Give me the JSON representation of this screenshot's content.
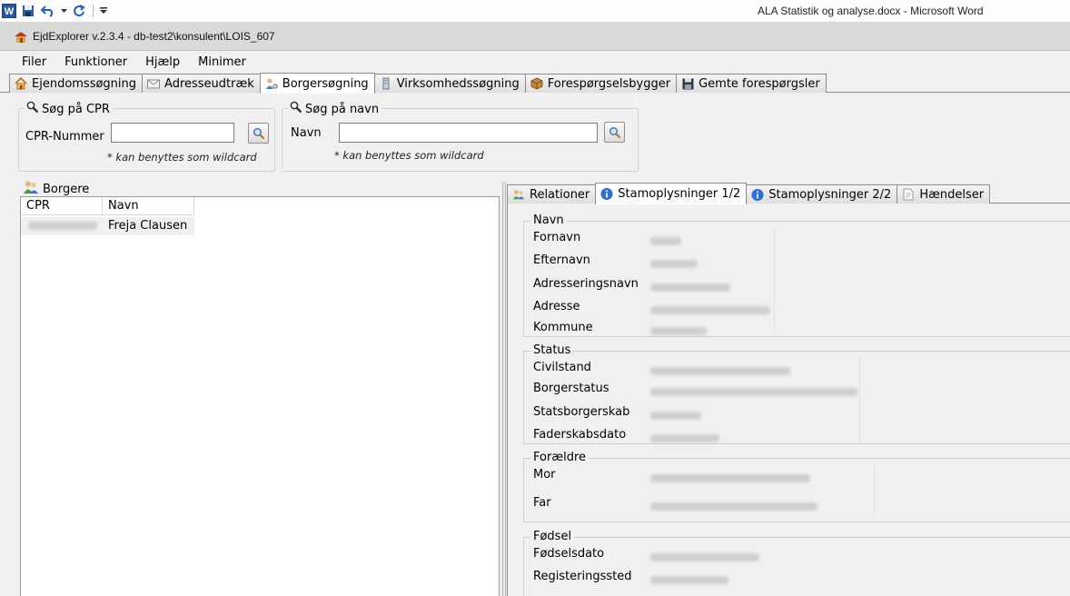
{
  "word": {
    "title": "ALA Statistik og analyse.docx  -  Microsoft Word",
    "icon_letter": "W"
  },
  "app": {
    "title": "EjdExplorer v.2.3.4 - db-test2\\konsulent\\LOIS_607"
  },
  "menu": [
    "Filer",
    "Funktioner",
    "Hjælp",
    "Minimer"
  ],
  "tabs": [
    {
      "label": "Ejendomssøgning",
      "icon": "house-icon"
    },
    {
      "label": "Adresseudtræk",
      "icon": "envelope-icon"
    },
    {
      "label": "Borgersøgning",
      "icon": "person-icon",
      "active": true
    },
    {
      "label": "Virksomhedssøgning",
      "icon": "building-icon"
    },
    {
      "label": "Forespørgselsbygger",
      "icon": "box-icon"
    },
    {
      "label": "Gemte forespørgsler",
      "icon": "floppy-icon"
    }
  ],
  "cpr_search": {
    "title": "Søg på CPR",
    "label": "CPR-Nummer",
    "value": "",
    "hint": "* kan benyttes som wildcard"
  },
  "name_search": {
    "title": "Søg på navn",
    "label": "Navn",
    "value": "",
    "hint": "* kan benyttes som wildcard"
  },
  "borgere": {
    "title": "Borgere",
    "columns": [
      "CPR",
      "Navn"
    ],
    "rows": [
      {
        "name": "Freja Clausen"
      }
    ]
  },
  "detail_tabs": [
    {
      "label": "Relationer",
      "icon": "people-icon"
    },
    {
      "label": "Stamoplysninger 1/2",
      "icon": "info-icon",
      "active": true
    },
    {
      "label": "Stamoplysninger 2/2",
      "icon": "info-icon"
    },
    {
      "label": "Hændelser",
      "icon": "document-icon"
    }
  ],
  "sections": {
    "navn": {
      "title": "Navn",
      "labels": [
        "Fornavn",
        "Efternavn",
        "Adresseringsnavn",
        "Adresse",
        "Kommune"
      ]
    },
    "status": {
      "title": "Status",
      "labels": [
        "Civilstand",
        "Borgerstatus",
        "Statsborgerskab",
        "Faderskabsdato"
      ]
    },
    "foraeldre": {
      "title": "Forældre",
      "labels": [
        "Mor",
        "Far"
      ]
    },
    "foedsel": {
      "title": "Fødsel",
      "labels": [
        "Fødselsdato",
        "Registeringssted"
      ]
    }
  }
}
